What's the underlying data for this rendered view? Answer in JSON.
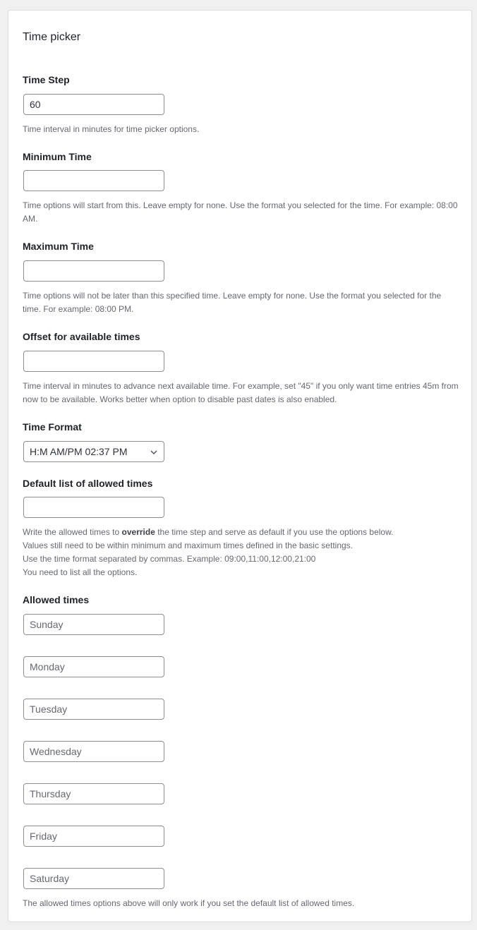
{
  "card": {
    "title": "Time picker"
  },
  "time_step": {
    "label": "Time Step",
    "value": "60",
    "description": "Time interval in minutes for time picker options."
  },
  "minimum_time": {
    "label": "Minimum Time",
    "value": "",
    "description": "Time options will start from this. Leave empty for none. Use the format you selected for the time. For example: 08:00 AM."
  },
  "maximum_time": {
    "label": "Maximum Time",
    "value": "",
    "description": "Time options will not be later than this specified time. Leave empty for none. Use the format you selected for the time. For example: 08:00 PM."
  },
  "offset": {
    "label": "Offset for available times",
    "value": "",
    "description": "Time interval in minutes to advance next available time. For example, set \"45\" if you only want time entries 45m from now to be available. Works better when option to disable past dates is also enabled."
  },
  "time_format": {
    "label": "Time Format",
    "selected": "H:M AM/PM 02:37 PM",
    "icon": "chevron-down-icon"
  },
  "default_allowed": {
    "label": "Default list of allowed times",
    "value": "",
    "description": {
      "line1_pre": "Write the allowed times to ",
      "line1_bold": "override",
      "line1_post": " the time step and serve as default if you use the options below.",
      "line2": "Values still need to be within minimum and maximum times defined in the basic settings.",
      "line3": "Use the time format separated by commas. Example: 09:00,11:00,12:00,21:00",
      "line4": "You need to list all the options."
    }
  },
  "allowed_times": {
    "label": "Allowed times",
    "days": [
      {
        "placeholder": "Sunday",
        "value": ""
      },
      {
        "placeholder": "Monday",
        "value": ""
      },
      {
        "placeholder": "Tuesday",
        "value": ""
      },
      {
        "placeholder": "Wednesday",
        "value": ""
      },
      {
        "placeholder": "Thursday",
        "value": ""
      },
      {
        "placeholder": "Friday",
        "value": ""
      },
      {
        "placeholder": "Saturday",
        "value": ""
      }
    ],
    "footer": "The allowed times options above will only work if you set the default list of allowed times."
  }
}
